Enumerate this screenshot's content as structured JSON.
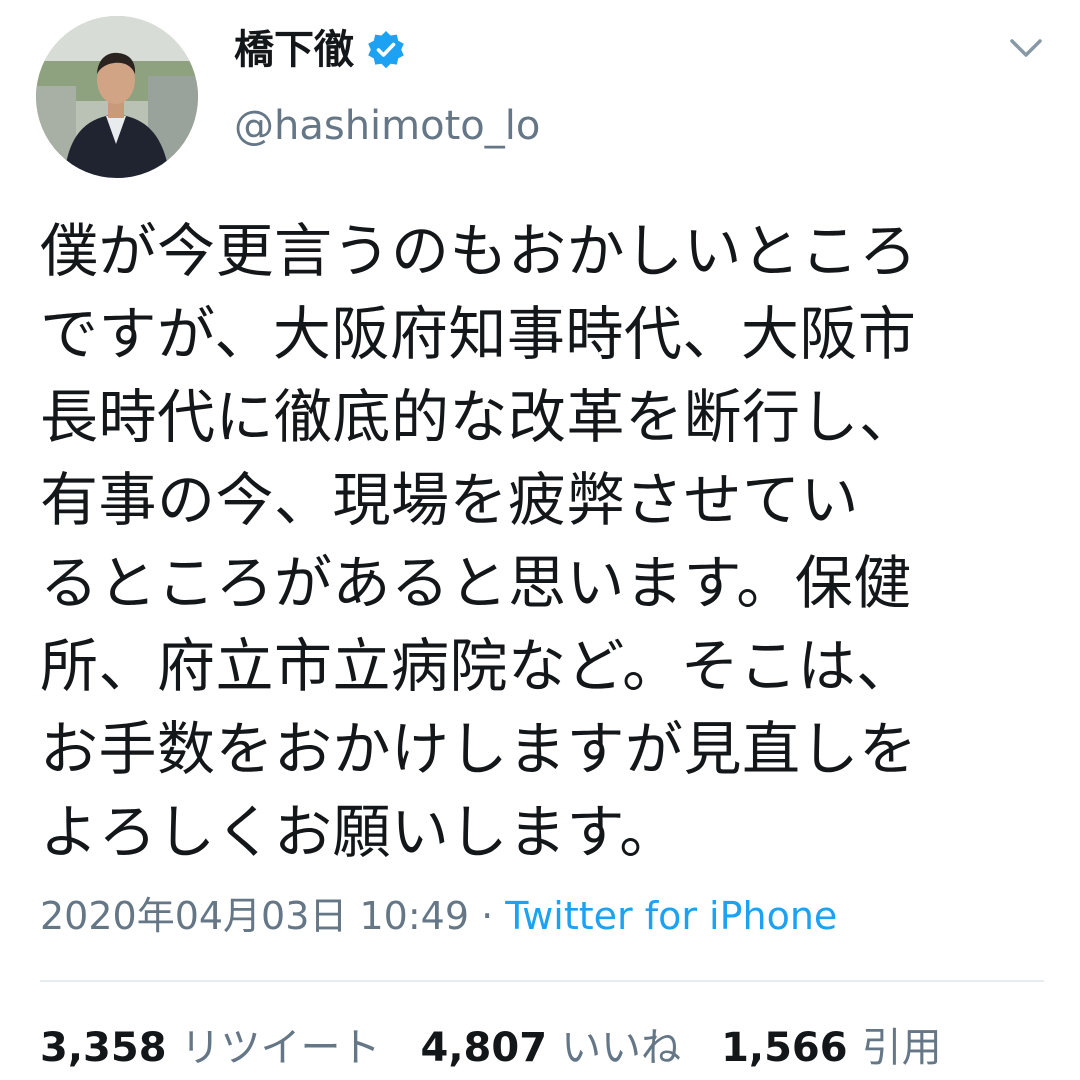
{
  "author": {
    "display_name": "橋下徹",
    "handle": "@hashimoto_lo",
    "verified": true,
    "avatar_icon": "user-avatar",
    "verified_icon": "verified-badge-icon"
  },
  "menu_icon": "chevron-down-icon",
  "tweet": {
    "lines": [
      "僕が今更言うのもおかしいところ",
      "ですが、大阪府知事時代、大阪市",
      "長時代に徹底的な改革を断行し、",
      "有事の今、現場を疲弊させてい",
      "るところがあると思います。保健",
      "所、府立市立病院など。そこは、",
      "お手数をおかけしますが見直しを",
      "よろしくお願いします。"
    ],
    "timestamp": "2020年04月03日 10:49",
    "separator": " · ",
    "source": "Twitter for iPhone"
  },
  "stats": {
    "retweets_count": "3,358",
    "retweets_label": "リツイート",
    "likes_count": "4,807",
    "likes_label": "いいね",
    "quotes_count": "1,566",
    "quotes_label": "引用"
  },
  "colors": {
    "text": "#14171a",
    "secondary": "#657786",
    "accent": "#1da1f2",
    "divider": "#e6ecf0"
  }
}
